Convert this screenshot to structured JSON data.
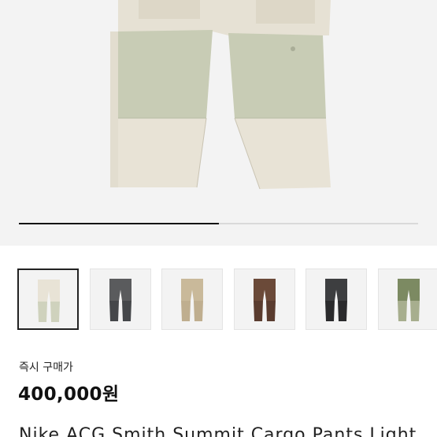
{
  "hero": {
    "image_description_icon": "pants-product-image",
    "carousel_progress": 0.5
  },
  "thumbnails": [
    {
      "colorway": "light-bone",
      "top": "#e8e3d6",
      "bottom": "#cfd2bd",
      "selected": true
    },
    {
      "colorway": "grey-black",
      "top": "#5a5b5d",
      "bottom": "#45474a",
      "selected": false
    },
    {
      "colorway": "khaki",
      "top": "#c9b99a",
      "bottom": "#bfae8f",
      "selected": false
    },
    {
      "colorway": "brown",
      "top": "#6b4a39",
      "bottom": "#5a3c2f",
      "selected": false
    },
    {
      "colorway": "black-grey",
      "top": "#3d3e40",
      "bottom": "#2a2a2c",
      "selected": false
    },
    {
      "colorway": "olive",
      "top": "#7c8a62",
      "bottom": "#a7ae8e",
      "selected": false
    }
  ],
  "purchase": {
    "label": "즉시 구매가",
    "price": "400,000원"
  },
  "product": {
    "title": "Nike ACG Smith Summit Cargo Pants Light"
  },
  "colors": {
    "text": "#222222",
    "progress": "#111111",
    "thumb_bg": "#f3f3f3"
  }
}
